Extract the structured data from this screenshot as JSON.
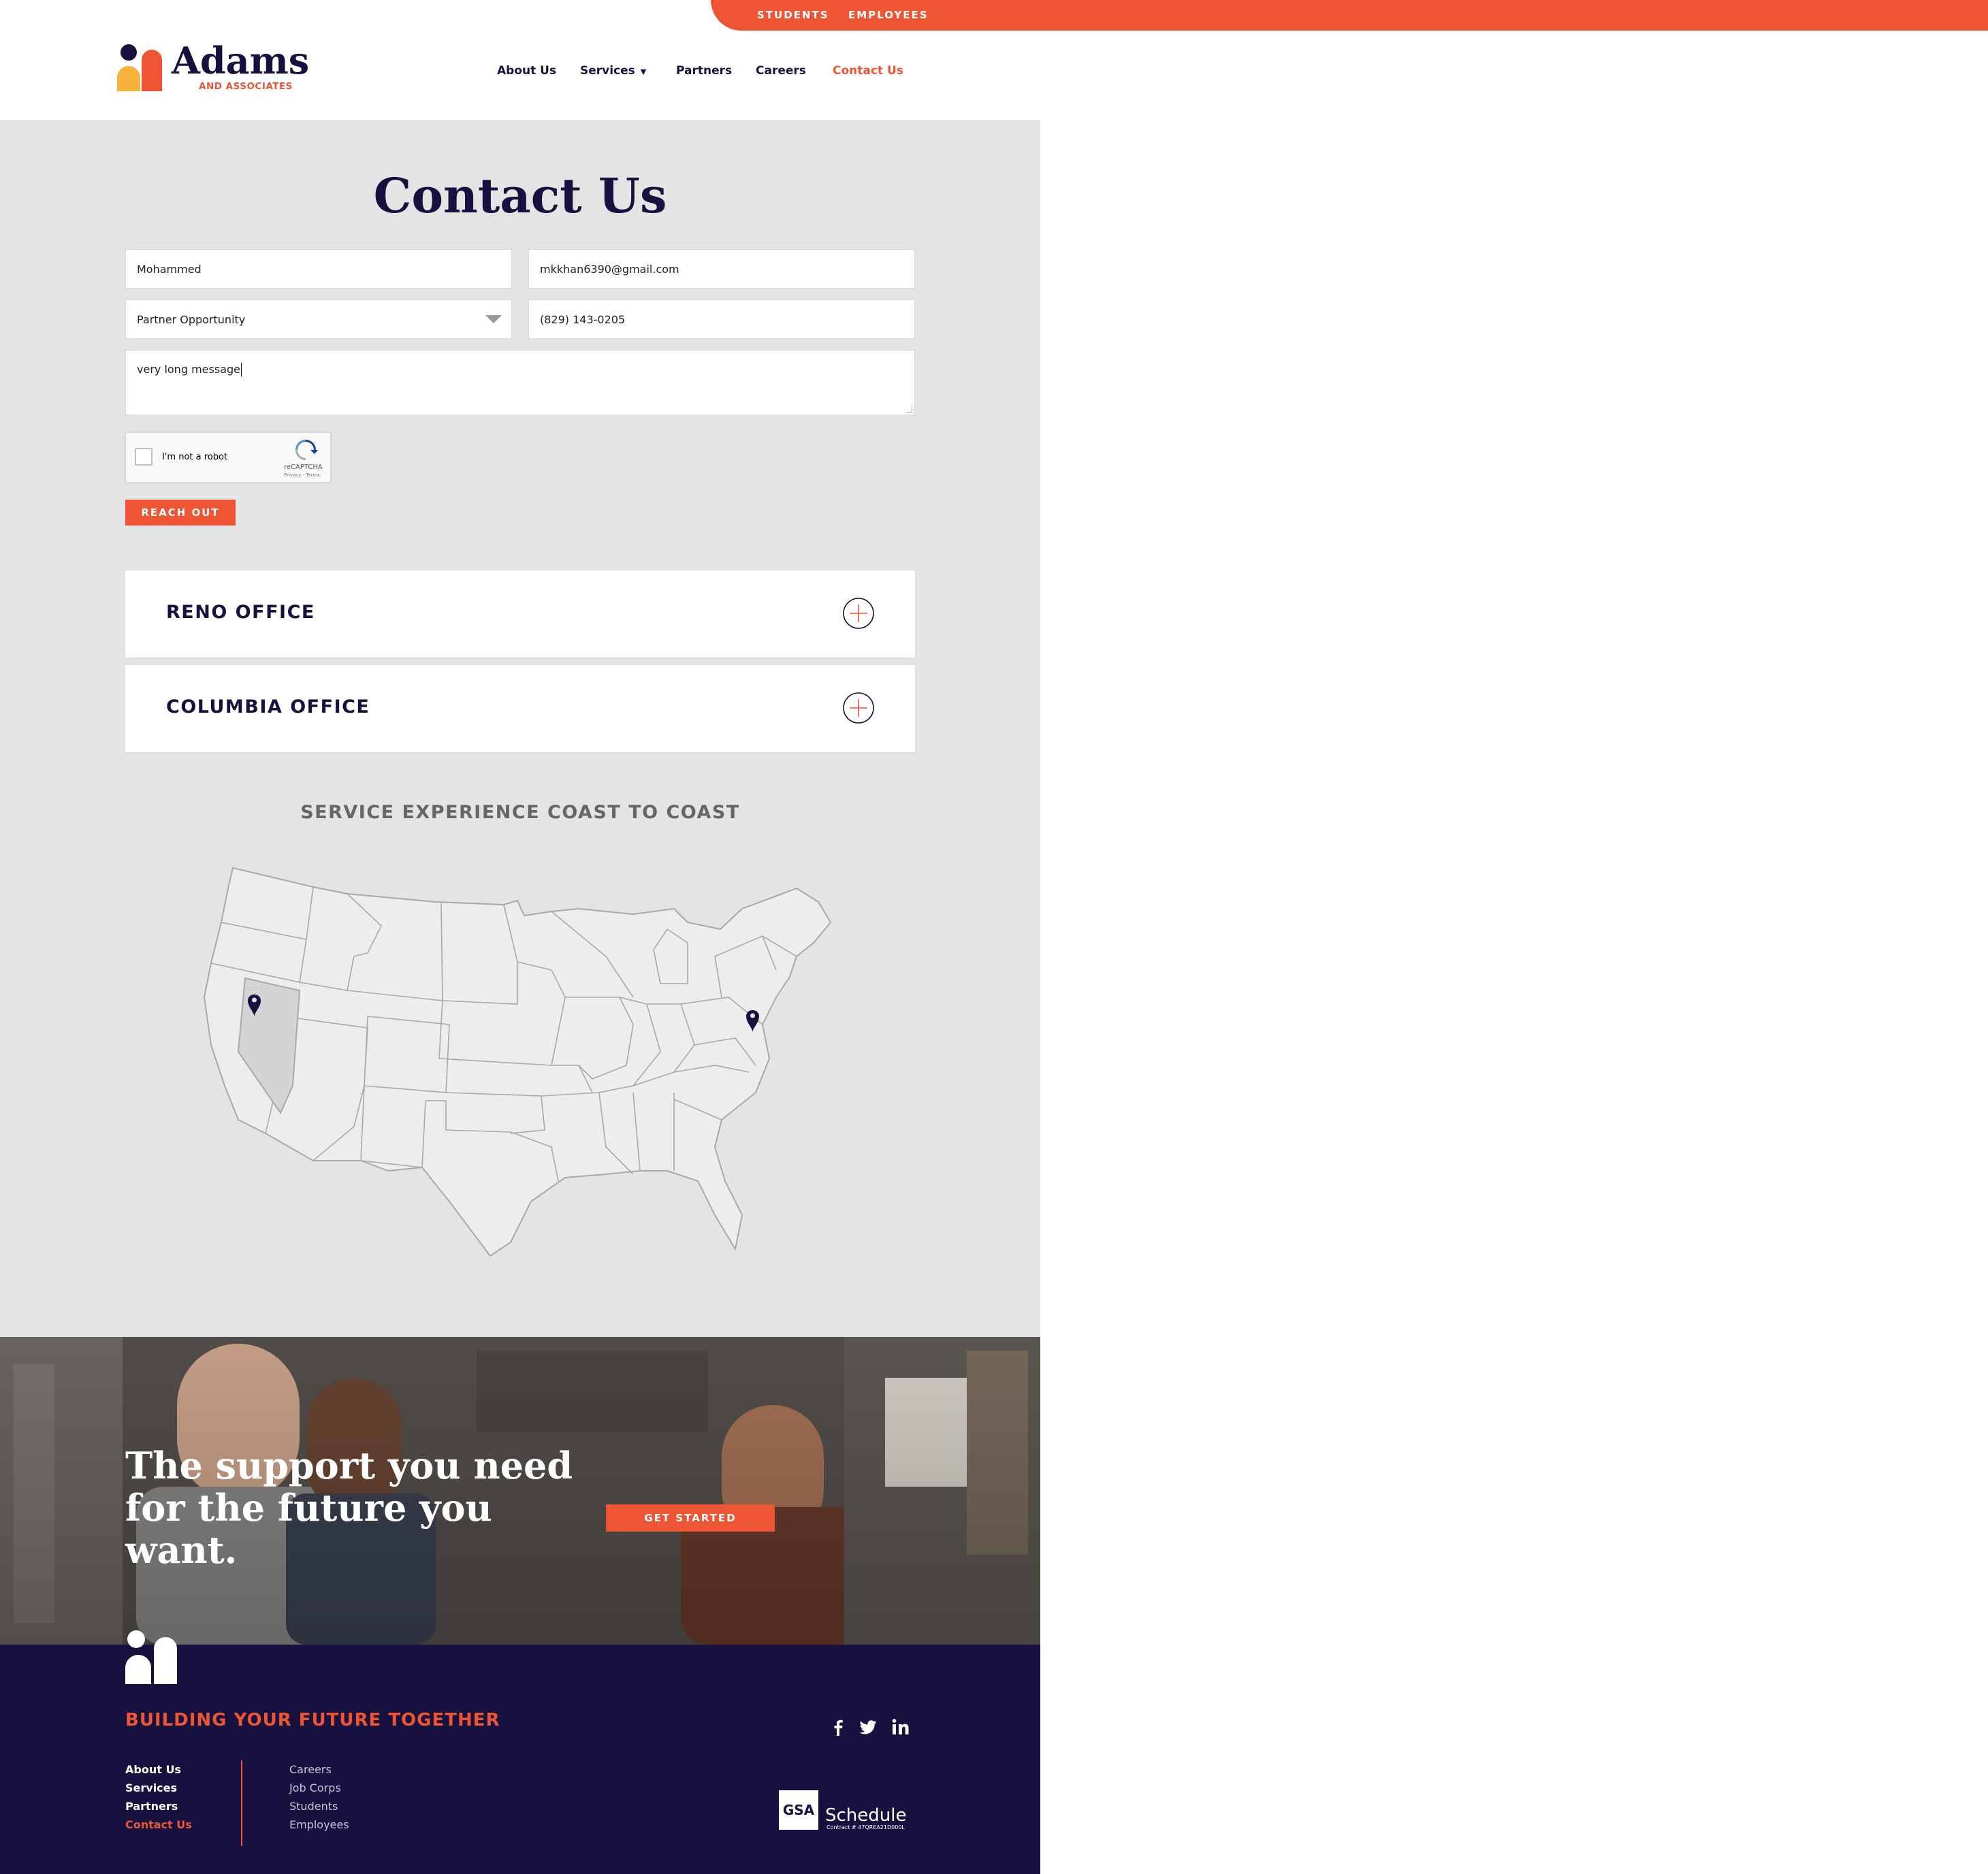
{
  "utility_nav": {
    "students": "STUDENTS",
    "employees": "EMPLOYEES"
  },
  "brand": {
    "name": "Adams",
    "sub": "AND ASSOCIATES",
    "primary_color": "#17113f",
    "accent_color": "#ee5535"
  },
  "nav": {
    "about": "About Us",
    "services": "Services",
    "partners": "Partners",
    "careers": "Careers",
    "contact": "Contact Us",
    "active": "Contact Us"
  },
  "contact": {
    "title": "Contact Us",
    "form": {
      "name_value": "Mohammed",
      "email_value": "mkkhan6390@gmail.com",
      "reason_value": "Partner Opportunity",
      "phone_value": "(829) 143-0205",
      "message_value": "very long message"
    },
    "captcha": {
      "label": "I'm not a robot",
      "brand": "reCAPTCHA",
      "terms": "Privacy - Terms"
    },
    "submit_label": "REACH OUT"
  },
  "offices": [
    {
      "title": "RENO OFFICE",
      "icon": "plus-circle-icon"
    },
    {
      "title": "COLUMBIA OFFICE",
      "icon": "plus-circle-icon"
    }
  ],
  "map": {
    "heading": "SERVICE EXPERIENCE COAST TO COAST",
    "highlighted_state": "Nevada",
    "pins": [
      "Reno, NV",
      "Columbia, MD"
    ]
  },
  "banner": {
    "line1": "The support you need",
    "line2": "for the future you want.",
    "cta": "GET STARTED"
  },
  "footer": {
    "tagline": "BUILDING YOUR FUTURE TOGETHER",
    "primary_links": [
      "About Us",
      "Services",
      "Partners",
      "Contact Us"
    ],
    "secondary_links": [
      "Careers",
      "Job Corps",
      "Students",
      "Employees"
    ],
    "social": [
      "facebook-icon",
      "twitter-icon",
      "linkedin-icon"
    ],
    "gsa": {
      "logo": "GSA",
      "schedule": "Schedule",
      "contract": "Contract # 47QREA21D000L"
    }
  }
}
